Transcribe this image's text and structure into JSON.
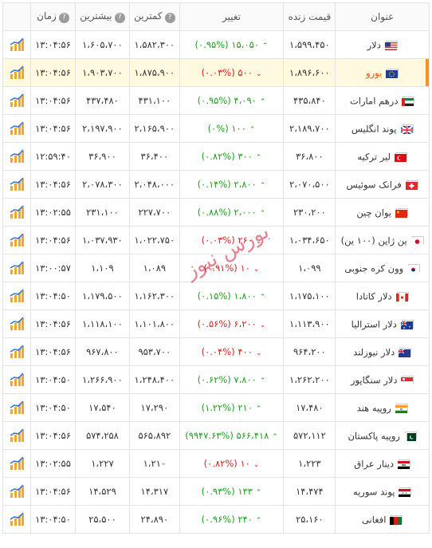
{
  "columns": {
    "name": "عنوان",
    "live": "قیمت زنده",
    "change": "تغییر",
    "low": "کمترین",
    "high": "بیشترین",
    "time": "زمان",
    "help_glyph": "?"
  },
  "highlight_color": "#f7941d",
  "colors": {
    "up": "#1aa01a",
    "down": "#d22020"
  },
  "rows": [
    {
      "name": "دلار",
      "flag": "us",
      "live": "۱،۵۹۹،۴۵۰",
      "change": "۱۵،۰۵۰ (۰.۹۵%)",
      "dir": "up",
      "low": "۱،۵۸۲،۳۰۰",
      "high": "۱،۶۰۵،۷۰۰",
      "time": "۱۳:۰۴:۵۶"
    },
    {
      "name": "یورو",
      "flag": "eu",
      "live": "۱،۸۹۶،۶۰۰",
      "change": "۵۰۰ (۰.۰۳%)",
      "dir": "down",
      "low": "۱،۸۷۵،۹۰۰",
      "high": "۱،۹۰۳،۷۰۰",
      "time": "۱۳:۰۴:۵۶"
    },
    {
      "name": "درهم امارات",
      "flag": "ae",
      "live": "۴۳۵،۸۴۰",
      "change": "۴،۰۹۰ (۰.۹۵%)",
      "dir": "up",
      "low": "۴۳۱،۱۰۰",
      "high": "۴۳۷،۴۸۰",
      "time": "۱۳:۰۴:۵۶"
    },
    {
      "name": "پوند انگلیس",
      "flag": "gb",
      "live": "۲،۱۸۹،۷۰۰",
      "change": "۱۰۰ (۰%)",
      "dir": "up",
      "low": "۲،۱۶۵،۹۰۰",
      "high": "۲،۱۹۷،۹۰۰",
      "time": "۱۳:۰۴:۵۶"
    },
    {
      "name": "لیر ترکیه",
      "flag": "tr",
      "live": "۳۶،۸۰۰",
      "change": "۳۰۰ (۰.۸۲%)",
      "dir": "up",
      "low": "۳۶،۴۰۰",
      "high": "۳۶،۹۰۰",
      "time": "۱۲:۵۹:۴۰"
    },
    {
      "name": "فرانک سوئیس",
      "flag": "ch",
      "live": "۲،۰۷۰،۵۰۰",
      "change": "۲،۸۰۰ (۰.۱۴%)",
      "dir": "up",
      "low": "۲،۰۴۸،۰۰۰",
      "high": "۲،۰۷۸،۳۰۰",
      "time": "۱۳:۰۴:۵۶"
    },
    {
      "name": "یوان چین",
      "flag": "cn",
      "live": "۲۳۰،۲۰۰",
      "change": "۲،۰۰۰ (۰.۸۸%)",
      "dir": "up",
      "low": "۲۲۷،۷۰۰",
      "high": "۲۳۱،۱۰۰",
      "time": "۱۳:۰۲:۵۵"
    },
    {
      "name": "ین ژاپن (۱۰۰ ین)",
      "flag": "jp",
      "live": "۱،۰۳۴،۶۵۰",
      "change": "۲۶۰ (۰.۰۳%)",
      "dir": "down",
      "low": "۱،۰۲۲،۷۵۰",
      "high": "۱،۰۳۷،۹۳۰",
      "time": "۱۳:۰۴:۵۶"
    },
    {
      "name": "وون کره جنوبی",
      "flag": "kr",
      "live": "۱،۰۹۹",
      "change": "۱۰ (۰.۹۱%)",
      "dir": "down",
      "low": "۱،۰۸۹",
      "high": "۱،۱۰۹",
      "time": "۱۳:۰۰:۵۷"
    },
    {
      "name": "دلار کانادا",
      "flag": "ca",
      "live": "۱،۱۷۵،۱۰۰",
      "change": "۱،۸۰۰ (۰.۱۵%)",
      "dir": "up",
      "low": "۱،۱۶۲،۳۰۰",
      "high": "۱،۱۷۹،۵۰۰",
      "time": "۱۳:۰۴:۵۰"
    },
    {
      "name": "دلار استرالیا",
      "flag": "au",
      "live": "۱،۱۱۳،۹۰۰",
      "change": "۶،۲۰۰ (۰.۵۶%)",
      "dir": "down",
      "low": "۱،۱۰۱،۸۰۰",
      "high": "۱،۱۱۸،۱۰۰",
      "time": "۱۳:۰۴:۵۶"
    },
    {
      "name": "دلار نیوزلند",
      "flag": "nz",
      "live": "۹۶۴،۲۰۰",
      "change": "۴۰۰ (۰.۰۴%)",
      "dir": "down",
      "low": "۹۵۳،۷۰۰",
      "high": "۹۶۷،۸۰۰",
      "time": "۱۳:۰۴:۵۶"
    },
    {
      "name": "دلار سنگاپور",
      "flag": "sg",
      "live": "۱،۲۶۲،۲۰۰",
      "change": "۷،۸۰۰ (۰.۶۲%)",
      "dir": "up",
      "low": "۱،۲۴۸،۴۰۰",
      "high": "۱،۲۶۶،۹۰۰",
      "time": "۱۳:۰۴:۵۰"
    },
    {
      "name": "روپیه هند",
      "flag": "in",
      "live": "۱۷،۴۸۰",
      "change": "۲۱۰ (۱.۲۲%)",
      "dir": "up",
      "low": "۱۷،۲۹۰",
      "high": "۱۷،۵۴۰",
      "time": "۱۳:۰۴:۵۰"
    },
    {
      "name": "روپیه پاکستان",
      "flag": "pk",
      "live": "۵۷۲،۱۱۲",
      "change": "۵۶۶،۴۱۸ (۹۹۴۷.۶۳%)",
      "dir": "up",
      "low": "۵۶۵،۸۹۲",
      "high": "۵۷۴،۲۵۸",
      "time": "۱۳:۰۴:۵۶"
    },
    {
      "name": "دینار عراق",
      "flag": "iq",
      "live": "۱،۲۲۳",
      "change": "۱۰ (۰.۸۲%)",
      "dir": "down",
      "low": "۱،۲۱۰",
      "high": "۱،۲۲۷",
      "time": "۱۳:۰۲:۵۵"
    },
    {
      "name": "پوند سوریه",
      "flag": "sy",
      "live": "۱۴،۴۷۴",
      "change": "۱۳۳ (۰.۹۳%)",
      "dir": "up",
      "low": "۱۴،۳۱۷",
      "high": "۱۴،۵۲۹",
      "time": "۱۳:۰۴:۵۶"
    },
    {
      "name": "افغانی",
      "flag": "af",
      "live": "۲۵،۱۶۰",
      "change": "۲۴۰ (۰.۹۶%)",
      "dir": "up",
      "low": "۲۴،۸۹۰",
      "high": "۲۵،۵۰۰",
      "time": "۱۳:۰۴:۵۰"
    }
  ],
  "highlighted_row": 1,
  "watermark": "بورس نیوز"
}
